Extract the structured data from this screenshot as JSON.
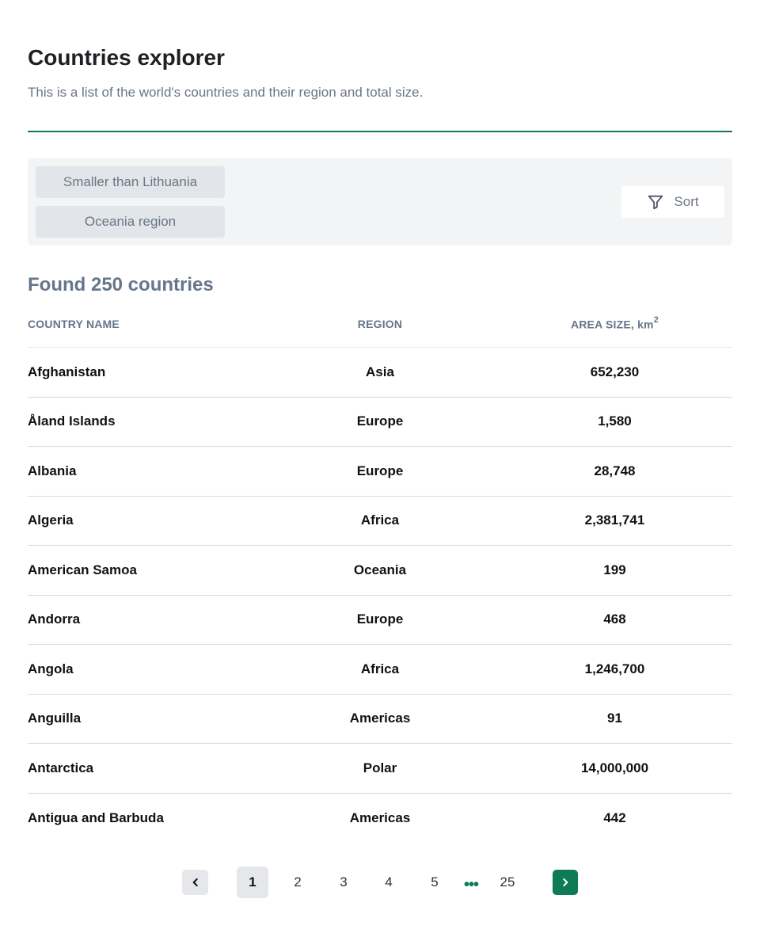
{
  "header": {
    "title": "Countries explorer",
    "subtitle": "This is a list of the world's countries and their region and total size."
  },
  "filters": {
    "chips": [
      "Smaller than Lithuania",
      "Oceania region"
    ],
    "sort_label": "Sort",
    "sort_icon": "filter-icon"
  },
  "results": {
    "found_label": "Found 250 countries"
  },
  "table": {
    "columns": [
      "COUNTRY NAME",
      "REGION",
      "AREA SIZE, km",
      "2"
    ],
    "rows": [
      {
        "name": "Afghanistan",
        "region": "Asia",
        "area": "652,230"
      },
      {
        "name": "Åland Islands",
        "region": "Europe",
        "area": "1,580"
      },
      {
        "name": "Albania",
        "region": "Europe",
        "area": "28,748"
      },
      {
        "name": "Algeria",
        "region": "Africa",
        "area": "2,381,741"
      },
      {
        "name": "American Samoa",
        "region": "Oceania",
        "area": "199"
      },
      {
        "name": "Andorra",
        "region": "Europe",
        "area": "468"
      },
      {
        "name": "Angola",
        "region": "Africa",
        "area": "1,246,700"
      },
      {
        "name": "Anguilla",
        "region": "Americas",
        "area": "91"
      },
      {
        "name": "Antarctica",
        "region": "Polar",
        "area": "14,000,000"
      },
      {
        "name": "Antigua and Barbuda",
        "region": "Americas",
        "area": "442"
      }
    ]
  },
  "pagination": {
    "current": "1",
    "pages": [
      "2",
      "3",
      "4",
      "5"
    ],
    "ellipsis": "•••",
    "last": "25",
    "prev_icon": "chevron-left-icon",
    "next_icon": "chevron-right-icon",
    "accent_color": "#0f7a56"
  }
}
